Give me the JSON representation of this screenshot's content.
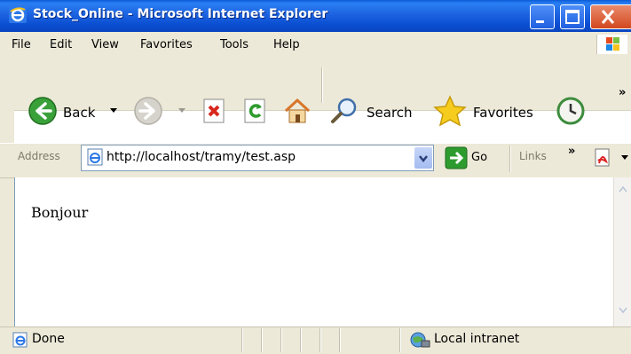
{
  "window": {
    "title": "Stock_Online - Microsoft Internet Explorer",
    "controls": [
      "minimize-button",
      "maximize-button",
      "close-button"
    ]
  },
  "menu": {
    "items": [
      "File",
      "Edit",
      "View",
      "Favorites",
      "Tools",
      "Help"
    ]
  },
  "toolbar": {
    "back_label": "Back",
    "search_label": "Search",
    "favorites_label": "Favorites",
    "overflow": "»"
  },
  "address": {
    "label": "Address",
    "url": "http://localhost/tramy/test.asp",
    "go_label": "Go",
    "links_label": "Links",
    "links_overflow": "»"
  },
  "page": {
    "text": "Bonjour"
  },
  "status": {
    "text": "Done",
    "zone": "Local intranet"
  },
  "colors": {
    "titlebar": "#0a58d6",
    "chrome": "#ece9d8",
    "close_button": "#d2481f"
  }
}
